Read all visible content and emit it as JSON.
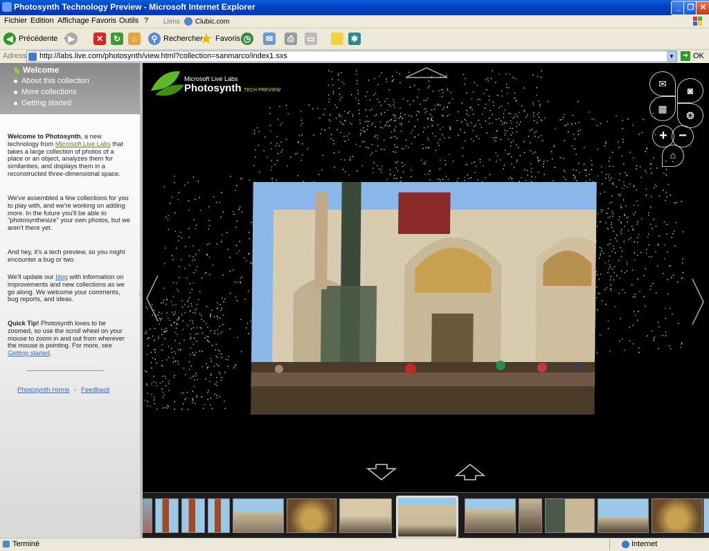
{
  "window": {
    "title": "Photosynth Technology Preview - Microsoft Internet Explorer"
  },
  "menu": [
    "Fichier",
    "Edition",
    "Affichage",
    "Favoris",
    "Outils",
    "?"
  ],
  "toolbar": {
    "back_label": "Précédente",
    "search_label": "Rechercher",
    "favorites_label": "Favoris",
    "links_label": "Liens",
    "links_item": "Clubic.com"
  },
  "address": {
    "label": "Adresse",
    "url": "http://labs.live.com/photosynth/view.html?collection=sanmarco/index1.sxs",
    "go_label": "OK"
  },
  "sidebar": {
    "nav": [
      "Welcome",
      "About this collection",
      "More collections",
      "Getting started"
    ],
    "welcome_title": "Welcome to Photosynth",
    "welcome_text_1": ", a new technology from ",
    "welcome_link": "Microsoft Live Labs",
    "welcome_text_2": " that takes a large collection of photos of a place or an object, analyzes them for similarities, and displays them in a reconstructed three-dimensional space.",
    "para2": "We've assembled a few collections for you to play with, and we're working on adding more. In the future you'll be able to \"photosynthesize\" your own photos, but we aren't there yet.",
    "para3": "And hey, it's a tech preview, so you might encounter a bug or two.",
    "para4_a": "We'll update our ",
    "para4_link": "blog",
    "para4_b": " with information on improvements and new collections as we go along. We welcome your comments, bug reports, and ideas.",
    "tip_title": "Quick Tip!",
    "tip_text": " Photosynth loves to be zoomed, so use the scroll wheel on your mouse to zoom in and out from wherever the mouse is pointing. For more, see ",
    "tip_link": "Getting started",
    "tip_end": ".",
    "footer_home": "Photosynth Home",
    "footer_sep": "-",
    "footer_feedback": "Feedback"
  },
  "viewer": {
    "logo_line1": "Microsoft Live Labs",
    "logo_line2": "Photosynth",
    "logo_line3": "TECH PREVIEW"
  },
  "status": {
    "left": "Terminé",
    "zone": "Internet"
  },
  "colors": {
    "titlebar": "#0044c8",
    "viewer_bg": "#000000",
    "leaf": "#8fcf3a"
  }
}
